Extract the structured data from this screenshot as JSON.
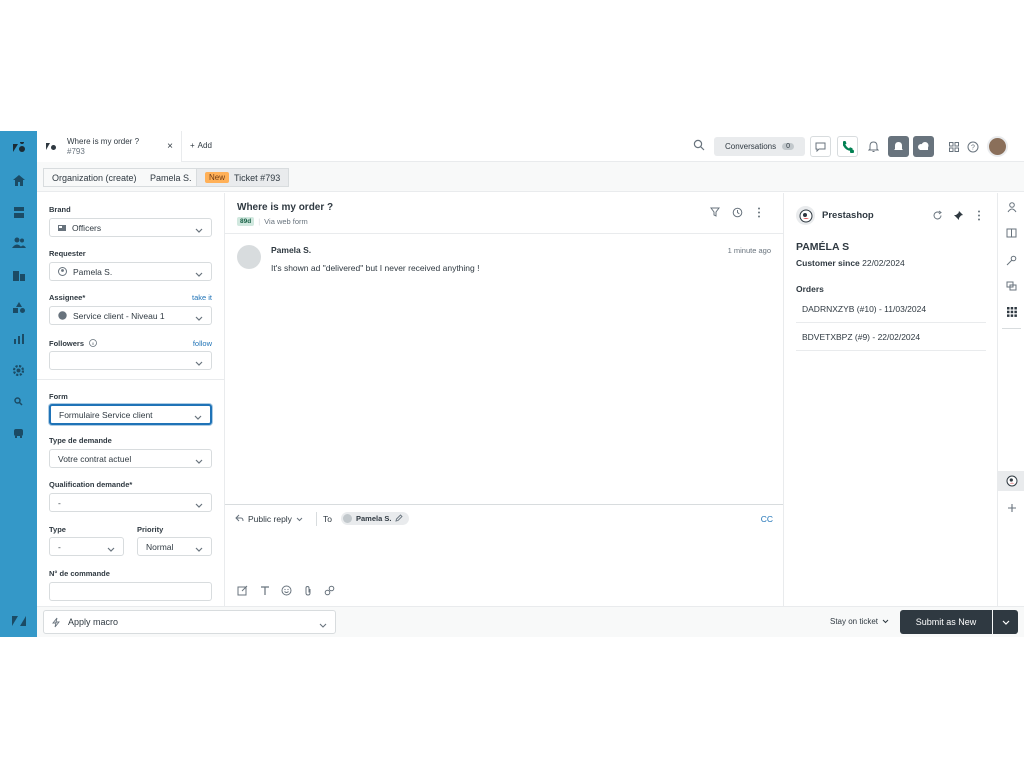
{
  "colors": {
    "nav_bg": "#3498c8",
    "accent": "#1f73b7",
    "new_badge": "#ffb057",
    "submit_bg": "#2f3941",
    "call_green": "#038153"
  },
  "tab": {
    "title": "Where is my order ?",
    "subtitle": "#793",
    "close": "×",
    "add_label": "Add"
  },
  "topbar": {
    "conversations_label": "Conversations",
    "conversations_count": "0"
  },
  "breadcrumb": {
    "org": "Organization (create)",
    "user": "Pamela S.",
    "status": "New",
    "ticket": "Ticket #793"
  },
  "props": {
    "brand_label": "Brand",
    "brand_value": "Officers",
    "requester_label": "Requester",
    "requester_value": "Pamela S.",
    "assignee_label": "Assignee*",
    "assignee_link": "take it",
    "assignee_value": "Service client - Niveau 1",
    "followers_label": "Followers",
    "followers_link": "follow",
    "followers_value": "",
    "form_label": "Form",
    "form_value": "Formulaire Service client",
    "type_demande_label": "Type de demande",
    "type_demande_value": "Votre contrat actuel",
    "qualification_label": "Qualification demande*",
    "qualification_value": "-",
    "type_label": "Type",
    "type_value": "-",
    "priority_label": "Priority",
    "priority_value": "Normal",
    "commande_label": "N° de commande",
    "commande_value": ""
  },
  "conversation": {
    "title": "Where is my order ?",
    "age_badge": "89d",
    "channel": "Via web form",
    "message": {
      "author": "Pamela S.",
      "time": "1 minute ago",
      "body": "It's shown ad \"delivered\" but I never received anything !"
    }
  },
  "composer": {
    "reply_type": "Public reply",
    "to_label": "To",
    "recipient": "Pamela S.",
    "cc_label": "CC"
  },
  "app": {
    "name": "Prestashop",
    "customer_name": "PAMÉLA S",
    "customer_since_label": "Customer since",
    "customer_since_date": "22/02/2024",
    "orders_label": "Orders",
    "orders": [
      {
        "text": "DADRNXZYB (#10) - 11/03/2024"
      },
      {
        "text": "BDVETXBPZ (#9) - 22/02/2024"
      }
    ]
  },
  "bottom": {
    "macro_label": "Apply macro",
    "stay_label": "Stay on ticket",
    "submit_label": "Submit as New"
  }
}
